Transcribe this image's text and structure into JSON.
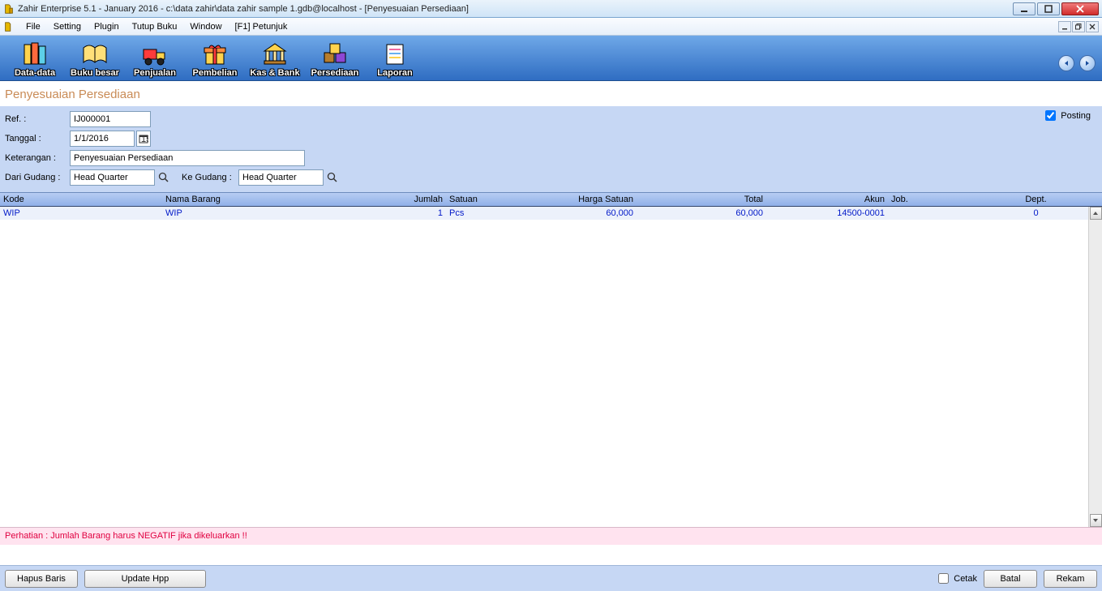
{
  "window": {
    "title": "Zahir Enterprise 5.1 - January 2016 - c:\\data zahir\\data zahir sample 1.gdb@localhost - [Penyesuaian Persediaan]"
  },
  "menu": {
    "items": [
      "File",
      "Setting",
      "Plugin",
      "Tutup Buku",
      "Window",
      "[F1] Petunjuk"
    ]
  },
  "toolbar": {
    "items": [
      {
        "label": "Data-data",
        "icon": "data"
      },
      {
        "label": "Buku besar",
        "icon": "ledger"
      },
      {
        "label": "Penjualan",
        "icon": "sales"
      },
      {
        "label": "Pembelian",
        "icon": "purchase"
      },
      {
        "label": "Kas & Bank",
        "icon": "cashbank"
      },
      {
        "label": "Persediaan",
        "icon": "inventory"
      },
      {
        "label": "Laporan",
        "icon": "report"
      }
    ]
  },
  "page": {
    "title": "Penyesuaian Persediaan",
    "labels": {
      "ref": "Ref. :",
      "tanggal": "Tanggal :",
      "keterangan": "Keterangan :",
      "dari_gudang": "Dari Gudang :",
      "ke_gudang": "Ke Gudang :",
      "posting": "Posting"
    },
    "fields": {
      "ref": "IJ000001",
      "tanggal": "1/1/2016",
      "keterangan": "Penyesuaian Persediaan",
      "dari_gudang": "Head Quarter",
      "ke_gudang": "Head Quarter",
      "posting_checked": true
    }
  },
  "grid": {
    "headers": {
      "kode": "Kode",
      "nama": "Nama Barang",
      "jumlah": "Jumlah",
      "satuan": "Satuan",
      "harga": "Harga Satuan",
      "total": "Total",
      "akun": "Akun",
      "job": "Job.",
      "dept": "Dept."
    },
    "rows": [
      {
        "kode": "WIP",
        "nama": "WIP",
        "jumlah": "1",
        "satuan": "Pcs",
        "harga": "60,000",
        "total": "60,000",
        "akun": "14500-0001",
        "job": "",
        "dept": "0"
      }
    ]
  },
  "warning": "Perhatian : Jumlah Barang harus NEGATIF jika dikeluarkan !!",
  "footer": {
    "hapus_baris": "Hapus Baris",
    "update_hpp": "Update Hpp",
    "cetak": "Cetak",
    "batal": "Batal",
    "rekam": "Rekam"
  }
}
